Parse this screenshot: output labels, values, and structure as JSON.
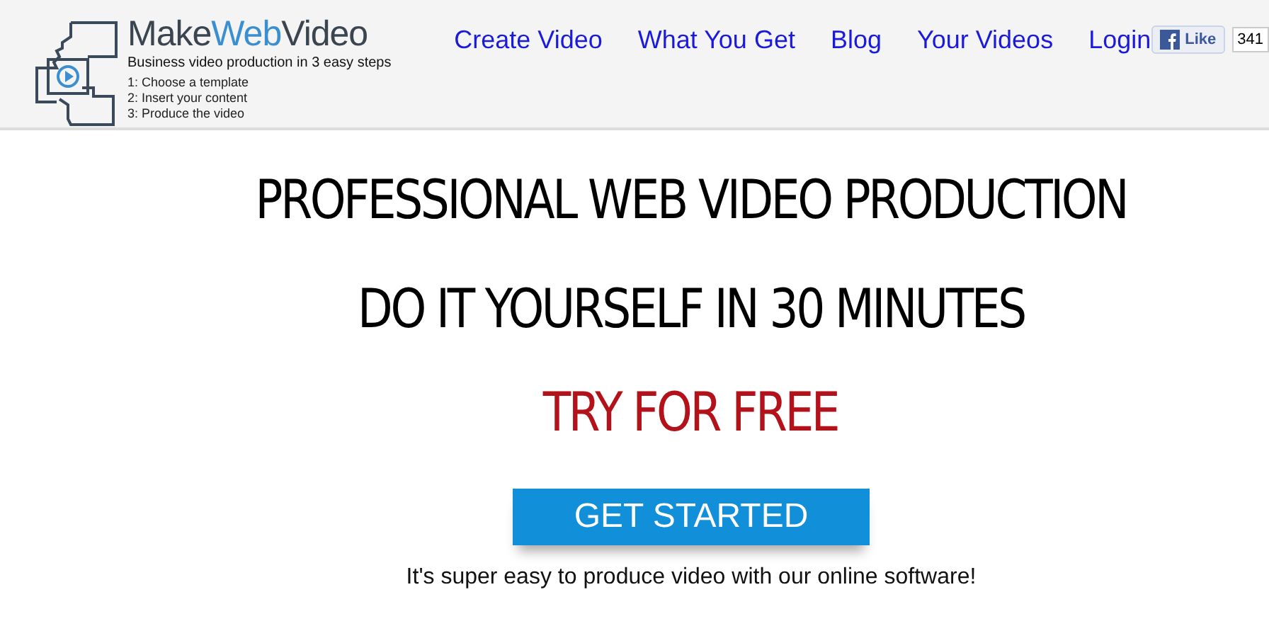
{
  "header": {
    "logo": {
      "prefix": "Make",
      "highlight": "Web",
      "suffix": "Video"
    },
    "tagline": "Business video production in 3 easy steps",
    "steps": [
      "1: Choose a template",
      "2: Insert your content",
      "3: Produce the video"
    ],
    "nav": [
      "Create Video",
      "What You Get",
      "Blog",
      "Your Videos",
      "Login"
    ],
    "like": {
      "label": "Like",
      "count": "341"
    }
  },
  "hero": {
    "headlines": [
      "PROFESSIONAL WEB VIDEO PRODUCTION",
      "DO IT YOURSELF IN 30 MINUTES"
    ],
    "offer": "TRY FOR FREE",
    "cta": "GET STARTED",
    "note": "It's super easy to produce video with our online software!"
  }
}
